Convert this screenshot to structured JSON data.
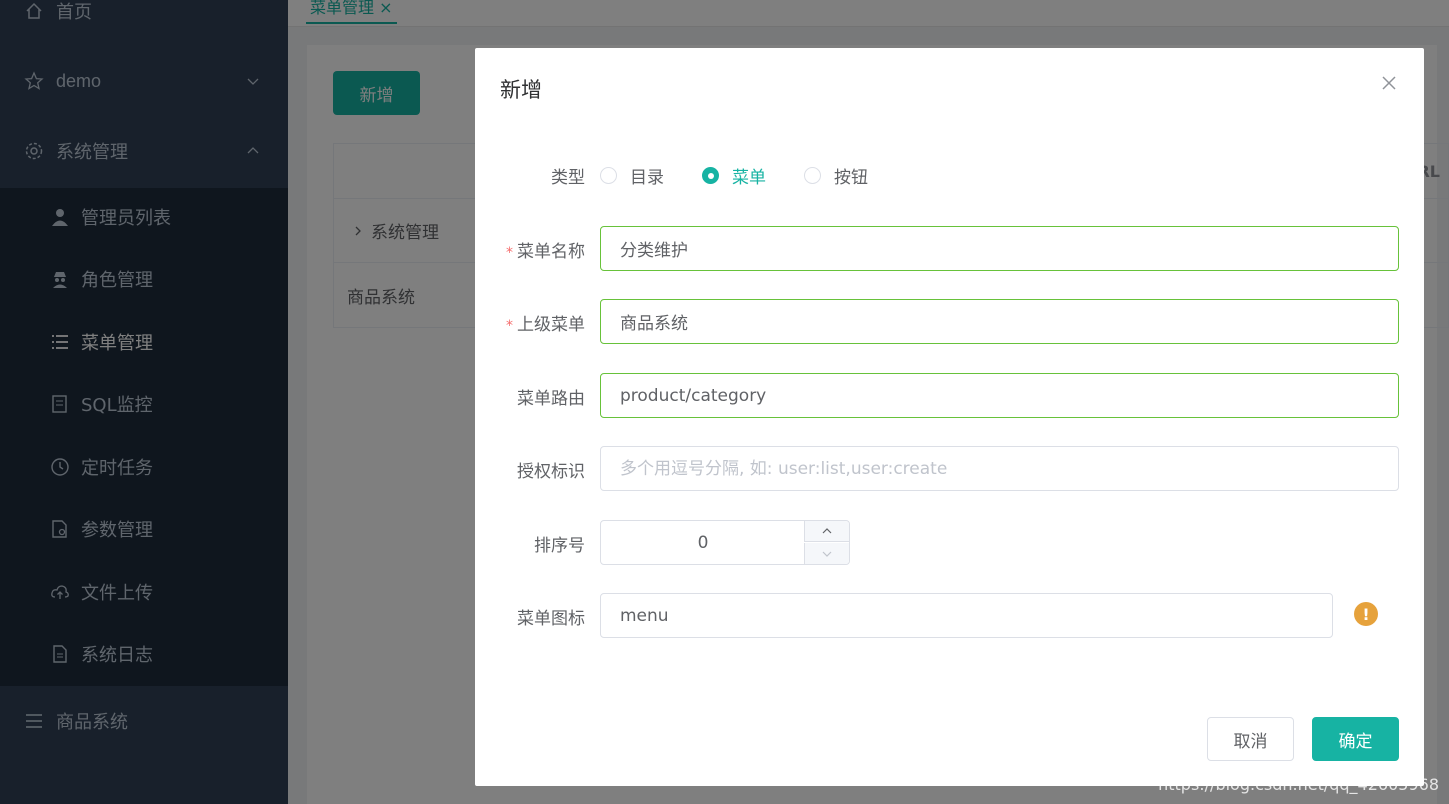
{
  "sidebar": {
    "items": [
      {
        "label": "首页",
        "icon": "home-icon"
      },
      {
        "label": "demo",
        "icon": "star-icon"
      },
      {
        "label": "系统管理",
        "icon": "gear-icon"
      },
      {
        "label": "商品系统",
        "icon": "list-icon"
      }
    ],
    "sub_items": [
      {
        "label": "管理员列表",
        "icon": "user-icon"
      },
      {
        "label": "角色管理",
        "icon": "spy-icon"
      },
      {
        "label": "菜单管理",
        "icon": "menu-list-icon"
      },
      {
        "label": "SQL监控",
        "icon": "sql-icon"
      },
      {
        "label": "定时任务",
        "icon": "clock-icon"
      },
      {
        "label": "参数管理",
        "icon": "doc-gear-icon"
      },
      {
        "label": "文件上传",
        "icon": "cloud-upload-icon"
      },
      {
        "label": "系统日志",
        "icon": "doc-icon"
      }
    ]
  },
  "topbar": {
    "tab_label": "菜单管理 ×"
  },
  "page": {
    "add_button": "新增",
    "table": {
      "col_url": "RL",
      "rows": [
        "系统管理",
        "商品系统"
      ]
    }
  },
  "dialog": {
    "title": "新增",
    "type_label": "类型",
    "type_options": [
      "目录",
      "菜单",
      "按钮"
    ],
    "type_selected": "菜单",
    "name_label": "菜单名称",
    "name_value": "分类维护",
    "parent_label": "上级菜单",
    "parent_value": "商品系统",
    "route_label": "菜单路由",
    "route_value": "product/category",
    "perms_label": "授权标识",
    "perms_placeholder": "多个用逗号分隔, 如: user:list,user:create",
    "order_label": "排序号",
    "order_value": "0",
    "icon_label": "菜单图标",
    "icon_value": "menu",
    "cancel_button": "取消",
    "confirm_button": "确定"
  },
  "watermark": "https://blog.csdn.net/qq_42605968",
  "colors": {
    "accent": "#17b3a3",
    "sidebar": "#304156",
    "valid": "#67c23a",
    "warning": "#e6a23c"
  }
}
